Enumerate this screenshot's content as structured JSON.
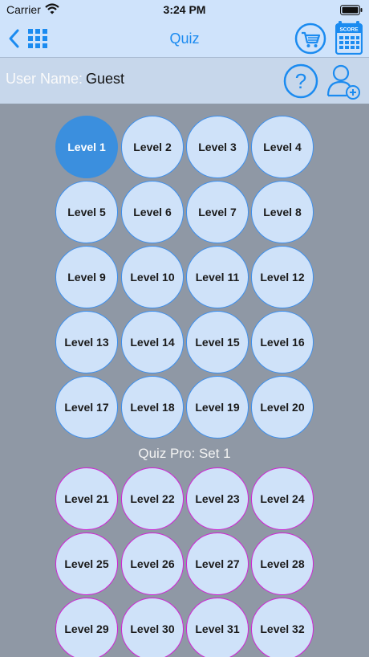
{
  "status_bar": {
    "carrier": "Carrier",
    "time": "3:24 PM"
  },
  "nav": {
    "title": "Quiz"
  },
  "user": {
    "label": "User Name:",
    "name": "Guest"
  },
  "colors": {
    "accent": "#1b8bf0",
    "pro_border": "#d31fd8",
    "selected_fill": "#3b8fde"
  },
  "levels": [
    "Level 1",
    "Level 2",
    "Level 3",
    "Level 4",
    "Level 5",
    "Level 6",
    "Level 7",
    "Level 8",
    "Level 9",
    "Level 10",
    "Level 11",
    "Level 12",
    "Level 13",
    "Level 14",
    "Level 15",
    "Level 16",
    "Level 17",
    "Level 18",
    "Level 19",
    "Level 20"
  ],
  "selected_level": "Level 1",
  "pro_section": {
    "title": "Quiz Pro: Set 1",
    "levels": [
      "Level 21",
      "Level 22",
      "Level 23",
      "Level 24",
      "Level 25",
      "Level 26",
      "Level 27",
      "Level 28",
      "Level 29",
      "Level 30",
      "Level 31",
      "Level 32"
    ]
  }
}
